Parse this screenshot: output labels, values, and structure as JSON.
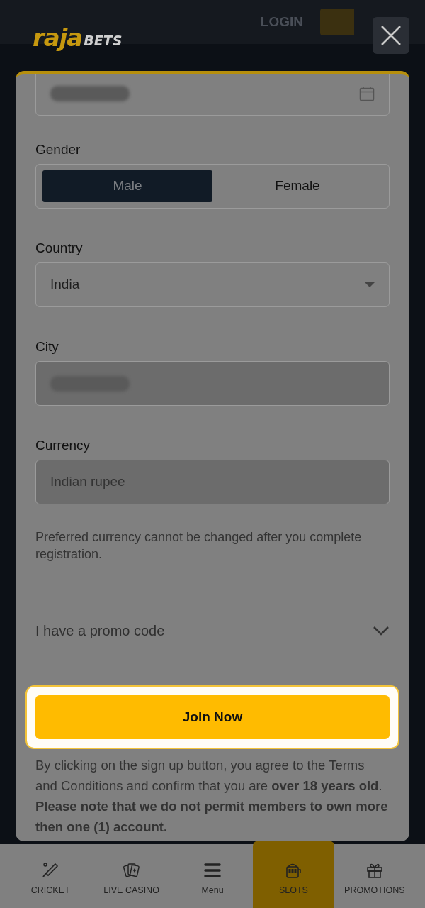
{
  "header": {
    "logo_main": "raja",
    "logo_sub": "BETS",
    "login": "LOGIN"
  },
  "form": {
    "gender": {
      "label": "Gender",
      "options": [
        {
          "label": "Male",
          "selected": true
        },
        {
          "label": "Female",
          "selected": false
        }
      ]
    },
    "country": {
      "label": "Country",
      "value": "India",
      "disabled": false
    },
    "city": {
      "label": "City",
      "disabled": true
    },
    "currency": {
      "label": "Currency",
      "value": "Indian rupee",
      "disabled": true
    },
    "currency_note": "Preferred currency cannot be changed after you complete registration.",
    "promo": {
      "label": "I have a promo code",
      "expanded": false
    },
    "join_button": {
      "label": "Join Now",
      "highlighted": true
    },
    "disclaimer": "By clicking on the sign up button, you agree to the Terms and Conditions and confirm that you are **over 18 years old**.",
    "notice": "Please note that we do not permit members to own more then one (1) account."
  },
  "bottom_nav": [
    {
      "label": "CRICKET",
      "selected": false
    },
    {
      "label": "LIVE CASINO",
      "selected": false
    },
    {
      "label": "Menu",
      "selected": false
    },
    {
      "label": "SLOTS",
      "selected": true
    },
    {
      "label": "PROMOTIONS",
      "selected": false
    }
  ]
}
